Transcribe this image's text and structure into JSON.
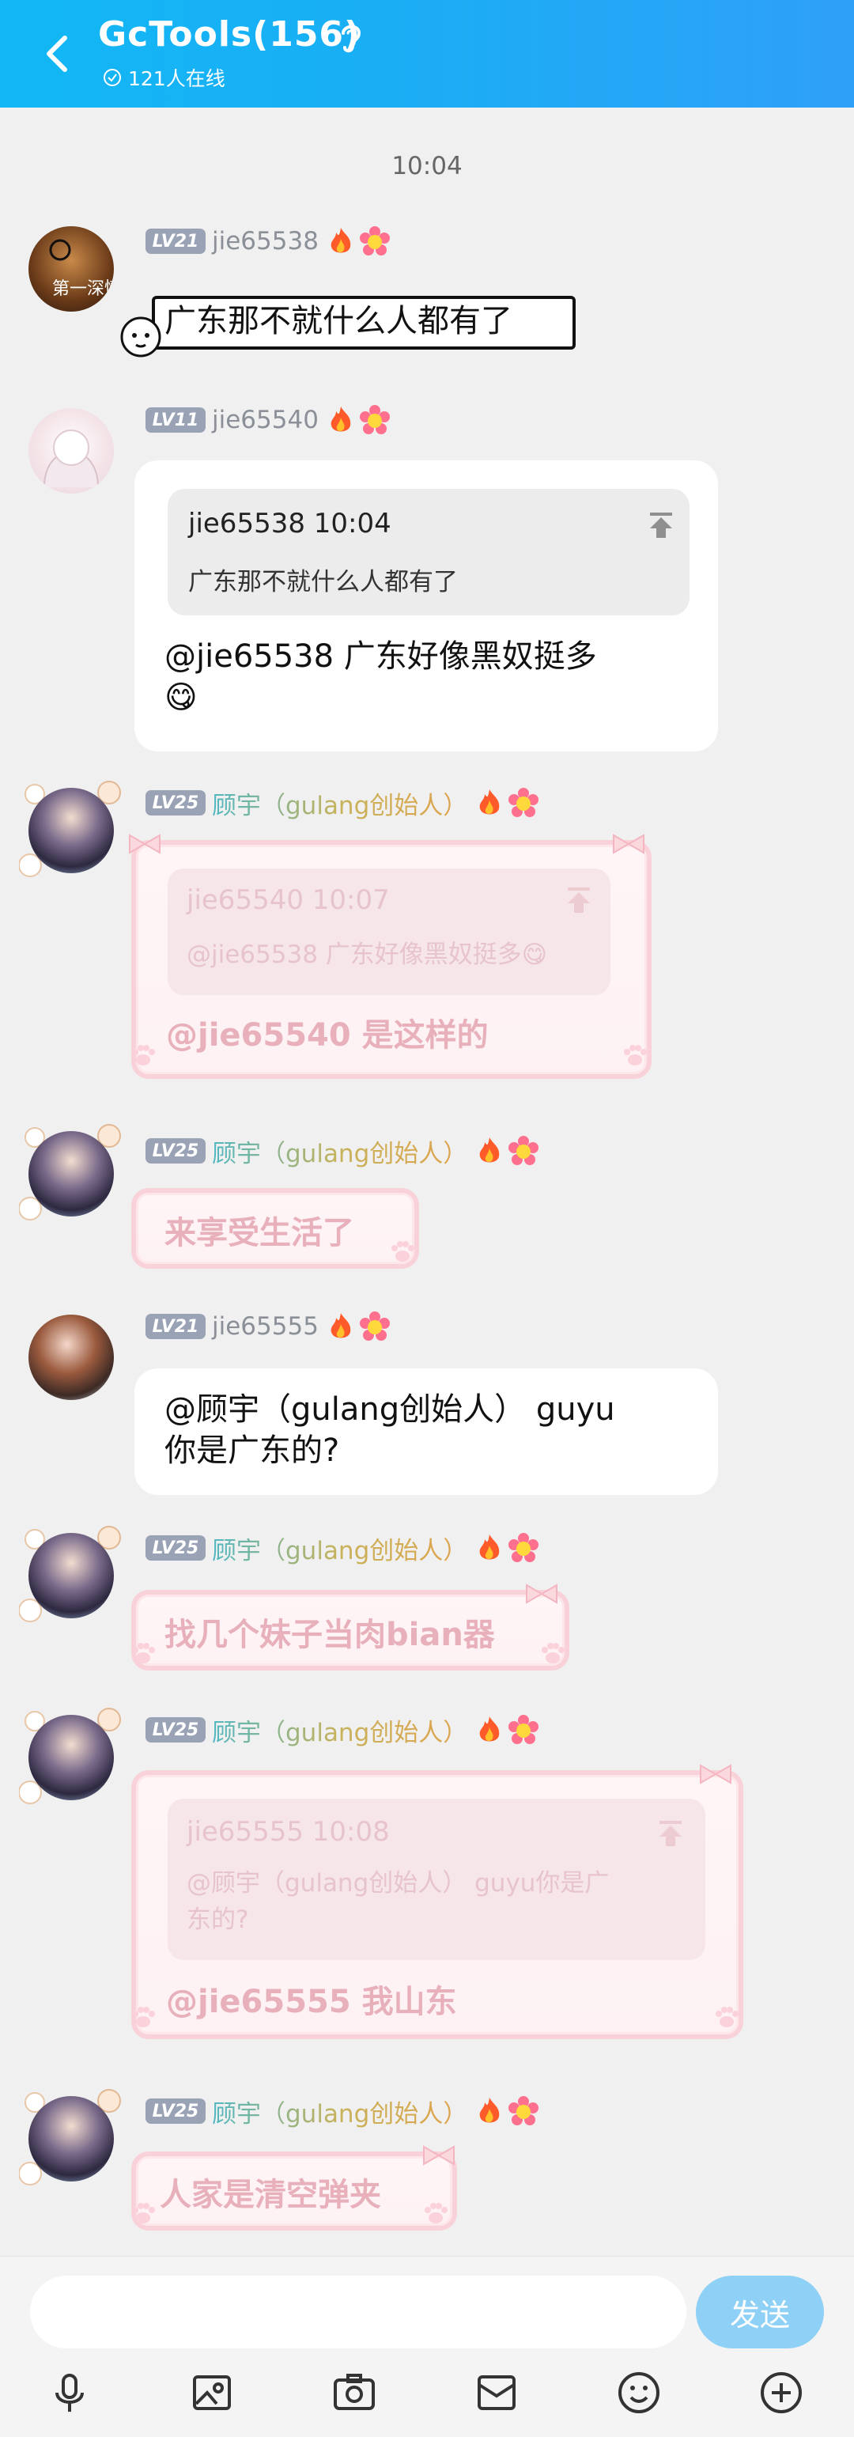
{
  "header": {
    "title": "GcTools(156)",
    "online": "121人在线"
  },
  "chat": {
    "time": "10:04",
    "messages": [
      {
        "level": "LV21",
        "nick": "jie65538",
        "text": "广东那不就什么人都有了"
      },
      {
        "level": "LV11",
        "nick": "jie65540",
        "quote_head": "jie65538 10:04",
        "quote_body": "广东那不就什么人都有了",
        "text": "@jie65538 广东好像黑奴挺多",
        "emoji": "😋"
      },
      {
        "level": "LV25",
        "nick": "顾宇（gulang创始人）",
        "quote_head": "jie65540 10:07",
        "quote_body": "@jie65538 广东好像黑奴挺多😋",
        "text": "@jie65540 是这样的"
      },
      {
        "level": "LV25",
        "nick": "顾宇（gulang创始人）",
        "text": "来享受生活了"
      },
      {
        "level": "LV21",
        "nick": "jie65555",
        "text_line1": "@顾宇（gulang创始人） guyu",
        "text_line2": "你是广东的?"
      },
      {
        "level": "LV25",
        "nick": "顾宇（gulang创始人）",
        "text": "找几个妹子当肉bian器"
      },
      {
        "level": "LV25",
        "nick": "顾宇（gulang创始人）",
        "quote_head": "jie65555 10:08",
        "quote_body_line1": "@顾宇（gulang创始人） guyu你是广",
        "quote_body_line2": "东的?",
        "text": "@jie65555 我山东"
      },
      {
        "level": "LV25",
        "nick": "顾宇（gulang创始人）",
        "text": "人家是清空弹夹"
      }
    ]
  },
  "input": {
    "placeholder": "",
    "send_label": "发送"
  },
  "toolbar": [
    "mic-icon",
    "image-icon",
    "camera-icon",
    "envelope-icon",
    "emoji-icon",
    "plus-icon"
  ]
}
